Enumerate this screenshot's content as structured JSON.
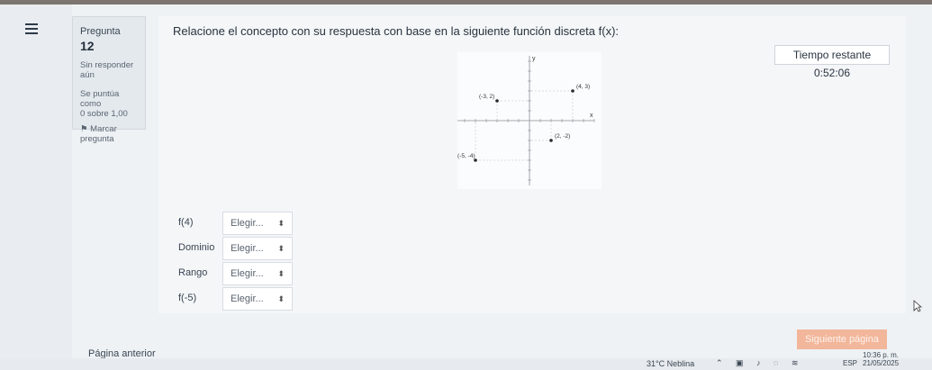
{
  "nav": {
    "menu_icon": "hamburger-icon"
  },
  "question_info": {
    "label": "Pregunta",
    "number": "12",
    "status_line1": "Sin responder",
    "status_line2": "aún",
    "score_line1": "Se puntúa como",
    "score_line2": "0 sobre 1,00",
    "flag_label": "Marcar",
    "flag_label2": "pregunta",
    "flag_icon": "flag-icon"
  },
  "question": {
    "text": "Relacione el concepto con su respuesta con base en la siguiente función discreta f(x):"
  },
  "timer": {
    "text": "Tiempo restante 0:52:06"
  },
  "graph": {
    "axis_x_label": "x",
    "axis_y_label": "y",
    "points": [
      {
        "label": "(4, 3)",
        "x": 4,
        "y": 3
      },
      {
        "label": "(-3, 2)",
        "x": -3,
        "y": 2
      },
      {
        "label": "(2, -2)",
        "x": 2,
        "y": -2
      },
      {
        "label": "(-5, -4)",
        "x": -5,
        "y": -4
      }
    ]
  },
  "matching": [
    {
      "label": "f(4)",
      "selected": "Elegir..."
    },
    {
      "label": "Dominio",
      "selected": "Elegir..."
    },
    {
      "label": "Rango",
      "selected": "Elegir..."
    },
    {
      "label": "f(-5)",
      "selected": "Elegir..."
    }
  ],
  "navigation": {
    "prev": "Página anterior",
    "next": "Siguiente página"
  },
  "taskbar": {
    "weather": "31°C  Neblina",
    "lang": "ESP",
    "time": "10:36 p. m.",
    "date": "21/05/2025"
  },
  "colors": {
    "next_button": "#f2b69b",
    "background": "#eef2f5"
  }
}
